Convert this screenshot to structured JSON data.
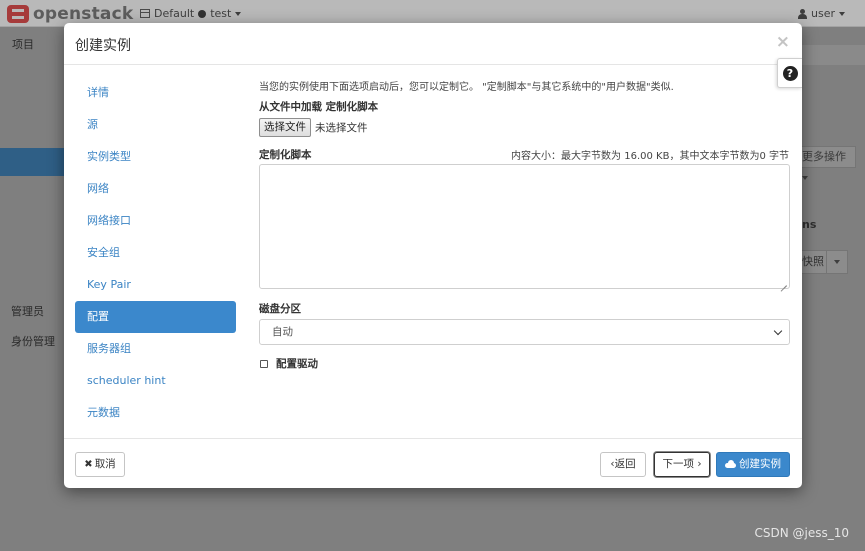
{
  "app": {
    "logo_text": "openstack",
    "domain": "Default",
    "project": "test",
    "user": "user"
  },
  "background": {
    "sidebar": [
      "项目",
      "管理员",
      "身份管理"
    ],
    "more_actions": "更多操作",
    "column_suffix": "ns",
    "snapshot": "快照"
  },
  "modal": {
    "title": "创建实例",
    "close_glyph": "×",
    "help_glyph": "?",
    "nav": [
      "详情",
      "源",
      "实例类型",
      "网络",
      "网络接口",
      "安全组",
      "Key Pair",
      "配置",
      "服务器组",
      "scheduler hint",
      "元数据"
    ],
    "active_index": 7,
    "intro": "当您的实例使用下面选项启动后，您可以定制它。 \"定制脚本\"与其它系统中的\"用户数据\"类似.",
    "file_load_label": "从文件中加载 定制化脚本",
    "choose_file": "选择文件",
    "no_file": "未选择文件",
    "script_label": "定制化脚本",
    "size_note": "内容大小：最大字节数为 16.00 KB，其中文本字节数为0 字节",
    "disk_label": "磁盘分区",
    "disk_value": "自动",
    "config_drive_label": "配置驱动",
    "config_drive_checked": false,
    "footer": {
      "cancel": "取消",
      "back": "返回",
      "next": "下一项",
      "create": "创建实例"
    }
  },
  "watermark": "CSDN @jess_10",
  "colors": {
    "accent": "#3b88cc",
    "link": "#3b84c4",
    "overlay": "#7f7f7f"
  }
}
